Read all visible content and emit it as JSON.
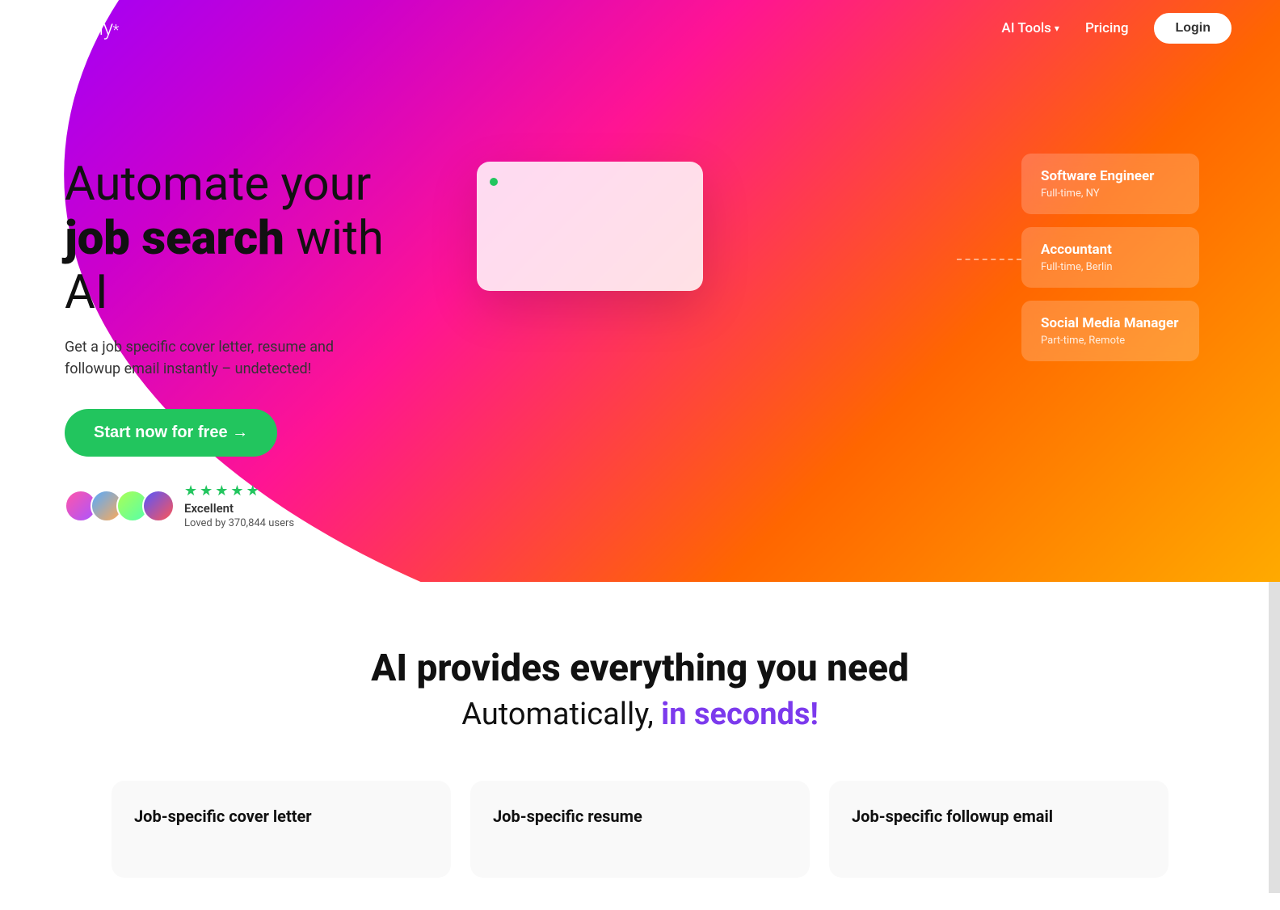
{
  "brand": {
    "name": "aiApply",
    "star": "*"
  },
  "nav": {
    "ai_tools_label": "AI Tools",
    "pricing_label": "Pricing",
    "login_label": "Login"
  },
  "hero": {
    "title_line1": "Automate your",
    "title_bold": "job search",
    "title_line2": " with AI",
    "subtitle": "Get a job specific cover letter, resume and followup email instantly – undetected!",
    "cta_label": "Start now for free →",
    "rating_label": "Excellent",
    "rating_sub": "Loved by 370,844 users",
    "stars": [
      "★",
      "★",
      "★",
      "★",
      "½"
    ]
  },
  "job_cards": [
    {
      "title": "Software Engineer",
      "sub": "Full-time, NY"
    },
    {
      "title": "Accountant",
      "sub": "Full-time, Berlin"
    },
    {
      "title": "Social Media Manager",
      "sub": "Part-time, Remote"
    }
  ],
  "lower": {
    "title": "AI provides everything you need",
    "subtitle_normal": "Automatically, ",
    "subtitle_accent": "in seconds!"
  },
  "features": [
    {
      "title": "Job-specific cover letter"
    },
    {
      "title": "Job-specific resume"
    },
    {
      "title": "Job-specific followup email"
    }
  ]
}
